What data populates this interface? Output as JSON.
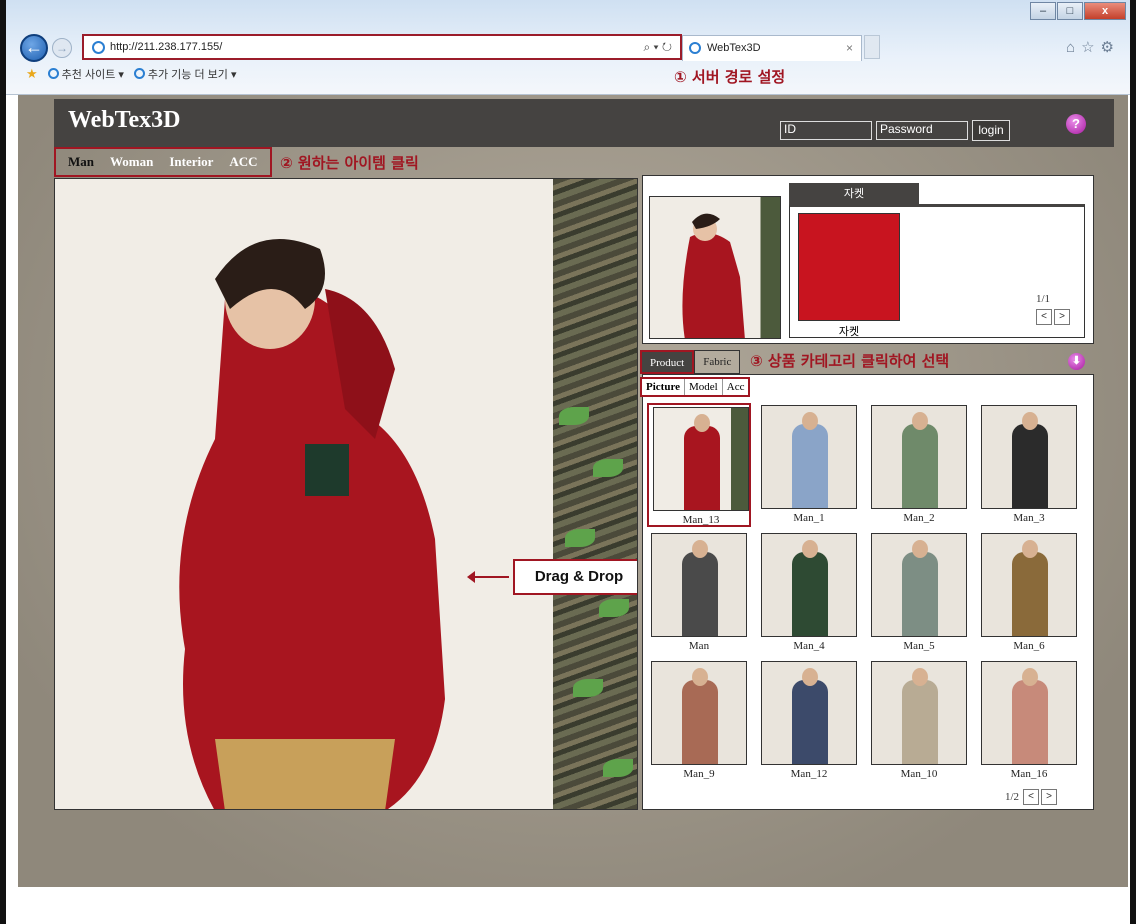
{
  "browser": {
    "url": "http://211.238.177.155/",
    "tab_title": "WebTex3D",
    "address_tools": "⌕ ▾ ↻",
    "favorites": [
      {
        "label": "추천 사이트 ▾"
      },
      {
        "label": "추가 기능 더 보기 ▾"
      }
    ]
  },
  "annotations": {
    "step1": "① 서버 경로 설정",
    "step2": "② 원하는 아이템 클릭",
    "step3": "③ 상품 카테고리 클릭하여 선택",
    "drag": "Drag & Drop"
  },
  "site": {
    "logo": "WebTex3D",
    "login": {
      "id_value": "ID",
      "password_value": "Password",
      "button": "login"
    },
    "help": "?",
    "categories": [
      {
        "label": "Man",
        "active": true
      },
      {
        "label": "Woman",
        "active": false
      },
      {
        "label": "Interior",
        "active": false
      },
      {
        "label": "ACC",
        "active": false
      }
    ]
  },
  "selected": {
    "tab_label": "자켓",
    "swatch_label": "자켓",
    "swatch_color": "#c8141f",
    "page": "1/1"
  },
  "product_tabs": [
    {
      "label": "Product",
      "active": true
    },
    {
      "label": "Fabric",
      "active": false
    }
  ],
  "sub_tabs": [
    {
      "label": "Picture",
      "active": true
    },
    {
      "label": "Model",
      "active": false
    },
    {
      "label": "Acc",
      "active": false
    }
  ],
  "products": [
    {
      "name": "Man_13",
      "color": "#a8151f"
    },
    {
      "name": "Man_1",
      "color": "#8aa4c8"
    },
    {
      "name": "Man_2",
      "color": "#6f8a6a"
    },
    {
      "name": "Man_3",
      "color": "#2b2b2b"
    },
    {
      "name": "Man",
      "color": "#4a4a4a"
    },
    {
      "name": "Man_4",
      "color": "#2e4a33"
    },
    {
      "name": "Man_5",
      "color": "#7d8e84"
    },
    {
      "name": "Man_6",
      "color": "#8a6a3a"
    },
    {
      "name": "Man_9",
      "color": "#a86a55"
    },
    {
      "name": "Man_12",
      "color": "#3c4a6a"
    },
    {
      "name": "Man_10",
      "color": "#b8ab94"
    },
    {
      "name": "Man_16",
      "color": "#c78a7a"
    }
  ],
  "list_page": "1/2",
  "pager": {
    "prev": "<",
    "next": ">"
  }
}
